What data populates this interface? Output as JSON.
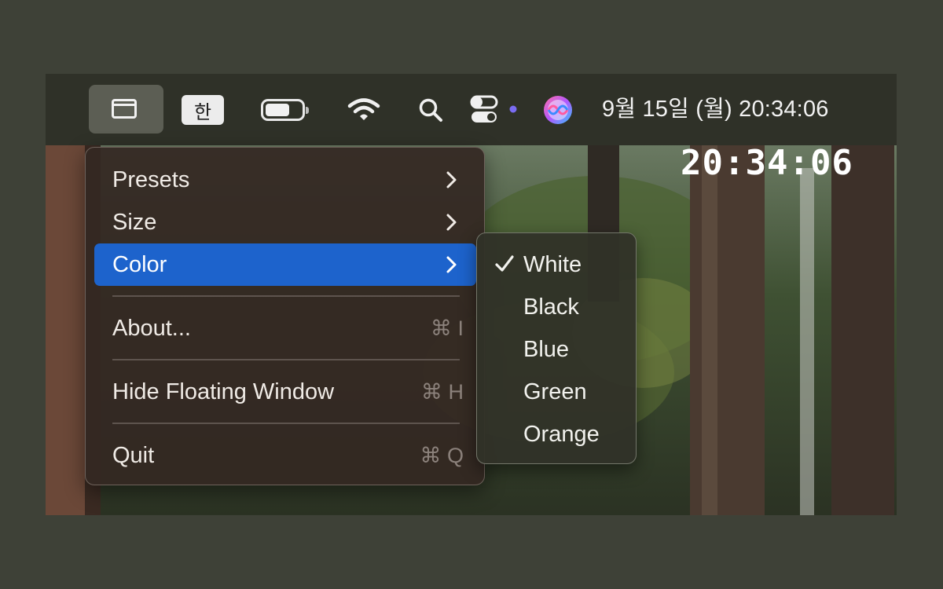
{
  "menubar": {
    "ime_label": "한",
    "datetime": "9월 15일 (월) 20:34:06",
    "icons": [
      "window-icon",
      "ime-icon",
      "battery-icon",
      "wifi-icon",
      "search-icon",
      "control-center-icon",
      "siri-icon"
    ]
  },
  "floating_clock": {
    "time": "20:34:06"
  },
  "menu": {
    "items": [
      {
        "label": "Presets",
        "submenu": true
      },
      {
        "label": "Size",
        "submenu": true
      },
      {
        "label": "Color",
        "submenu": true,
        "selected": true
      },
      {
        "label": "About...",
        "shortcut": "⌘ I"
      },
      {
        "label": "Hide Floating Window",
        "shortcut": "⌘ H"
      },
      {
        "label": "Quit",
        "shortcut": "⌘ Q"
      }
    ]
  },
  "color_submenu": {
    "items": [
      {
        "label": "White",
        "checked": true
      },
      {
        "label": "Black"
      },
      {
        "label": "Blue"
      },
      {
        "label": "Green"
      },
      {
        "label": "Orange"
      }
    ]
  },
  "colors": {
    "selection": "#1d63cc",
    "control_center_dot": "#7a6cf2"
  }
}
